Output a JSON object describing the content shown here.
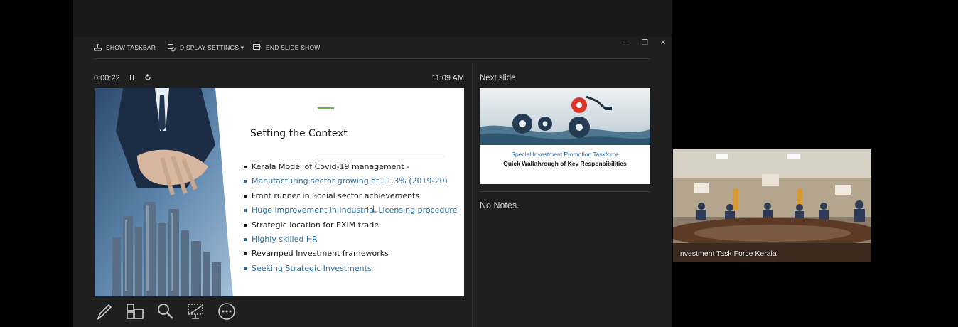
{
  "toolbar": {
    "show_taskbar": "SHOW TASKBAR",
    "display_settings": "DISPLAY SETTINGS ▾",
    "end_slide_show": "END SLIDE SHOW",
    "minimize": "–",
    "restore": "❐",
    "close": "✕"
  },
  "presenter": {
    "timer": "0:00:22",
    "clock": "11:09 AM"
  },
  "current_slide": {
    "title": "Setting the Context",
    "bullets": [
      "Kerala Model of Covid-19 management -",
      "Manufacturing sector growing at 11.3% (2019-20)",
      "Front runner in Social sector achievements",
      "Huge improvement in Industrial Licensing procedure",
      "Strategic location for EXIM trade",
      "Highly skilled HR",
      "Revamped Investment frameworks",
      "Seeking Strategic Investments"
    ]
  },
  "next_slide": {
    "label": "Next slide",
    "title_line1": "Special Investment Promotion Taskforce",
    "title_line2": "Quick Walkthrough of Key Responsibilities"
  },
  "notes": {
    "text": "No Notes."
  },
  "video_tile": {
    "participant_name": "Investment Task Force Kerala"
  },
  "tools": [
    "pen-icon",
    "see-all-slides-icon",
    "zoom-icon",
    "black-screen-icon",
    "more-options-icon"
  ],
  "colors": {
    "panel_bg": "#1f1f1f",
    "bullet_blue": "#2e6e9e",
    "accent_green": "#6ab04c"
  }
}
